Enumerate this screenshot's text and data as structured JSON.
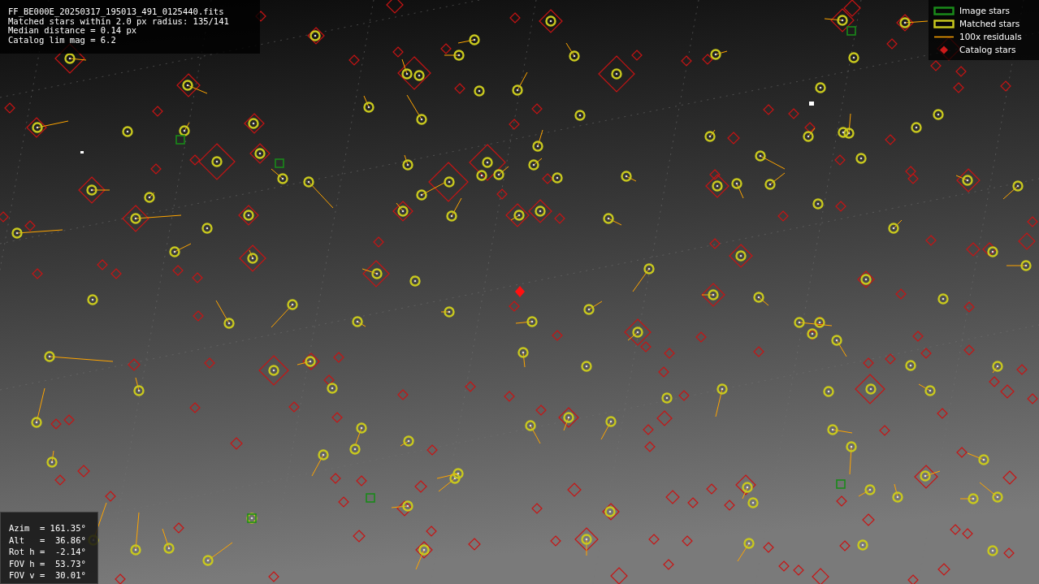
{
  "header": {
    "lines": [
      "FF_BE000E_20250317_195013_491_0125440.fits",
      "Matched stars within 2.0 px radius: 135/141",
      "Median distance = 0.14 px",
      "Catalog lim mag = 6.2"
    ]
  },
  "legend": [
    {
      "kind": "image",
      "label": "Image stars",
      "color": "#1a8a1a"
    },
    {
      "kind": "matched",
      "label": "Matched stars",
      "color": "#c8c81e"
    },
    {
      "kind": "residual",
      "label": "100x residuals",
      "color": "#ffa500"
    },
    {
      "kind": "catalog",
      "label": "Catalog stars",
      "color": "#cc1a1a"
    }
  ],
  "pointing": {
    "lines": [
      "Azim  = 161.35°",
      "Alt   =  36.86°",
      "Rot h =  -2.14°",
      "FOV h =  53.73°",
      "FOV v =  30.01°"
    ]
  }
}
